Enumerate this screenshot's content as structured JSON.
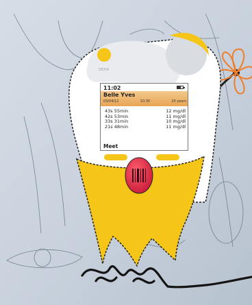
{
  "device": {
    "brand_label": "DEXIA",
    "screen": {
      "time": "11:02",
      "battery_icon": "battery-icon",
      "patient_name": "Belle Yves",
      "info": {
        "date": "03/04/12",
        "clock": "10:30",
        "age": "20 years"
      },
      "readings": [
        {
          "duration": "43s 55min",
          "value": "12 mg/dl"
        },
        {
          "duration": "42s 53min",
          "value": "11 mg/dl"
        },
        {
          "duration": "33s 31min",
          "value": "10 mg/dl"
        },
        {
          "duration": "21s 48min",
          "value": "11 mg/dl"
        }
      ],
      "footer_label": "Meet"
    },
    "buttons": [
      "left-soft-key",
      "right-soft-key",
      "scan-button"
    ]
  },
  "colors": {
    "accent_yellow": "#f5c518",
    "orange_header": "#eaa85a",
    "scan_red": "#e0304a",
    "flower_orange": "#ef7d2a",
    "paper_blue": "#cfd8e4"
  }
}
